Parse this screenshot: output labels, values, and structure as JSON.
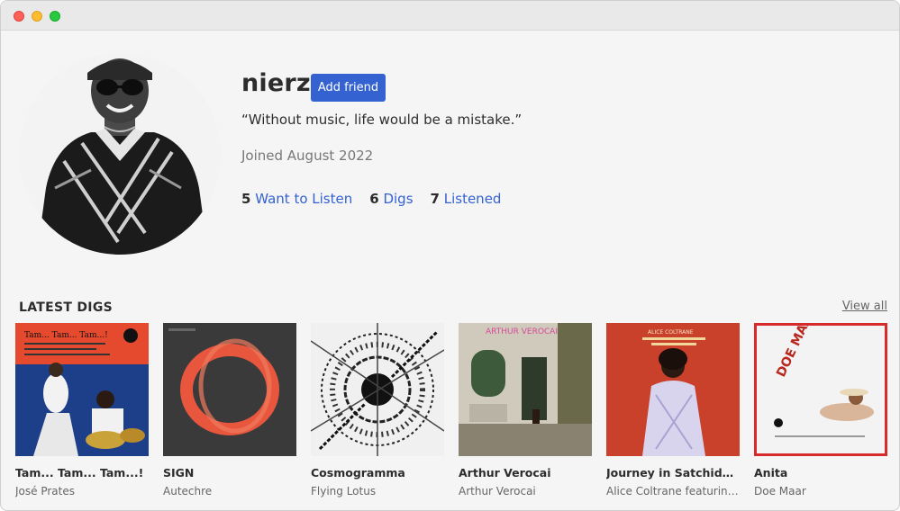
{
  "profile": {
    "username": "nierz",
    "add_friend_label": "Add friend",
    "quote": "“Without music, life would be a mistake.”",
    "joined": "Joined August 2022",
    "stats": [
      {
        "count": "5",
        "label": "Want to Listen"
      },
      {
        "count": "6",
        "label": "Digs"
      },
      {
        "count": "7",
        "label": "Listened"
      }
    ]
  },
  "latest_digs": {
    "title": "LATEST DIGS",
    "view_all_label": "View all",
    "items": [
      {
        "title": "Tam... Tam... Tam...!",
        "artist": "José Prates",
        "cover_text": "Tam... Tam... Tam...!"
      },
      {
        "title": "SIGN",
        "artist": "Autechre",
        "cover_text": ""
      },
      {
        "title": "Cosmogramma",
        "artist": "Flying Lotus",
        "cover_text": ""
      },
      {
        "title": "Arthur Verocai",
        "artist": "Arthur Verocai",
        "cover_text": "ARTHUR VEROCAI"
      },
      {
        "title": "Journey in Satchidananda",
        "artist": "Alice Coltrane featuring Pharoah Sanders",
        "cover_text": "ALICE COLTRANE"
      },
      {
        "title": "Anita",
        "artist": "Doe Maar",
        "cover_text": "DOE MAAR"
      }
    ]
  },
  "colors": {
    "accent": "#3462d1",
    "background": "#f5f5f5"
  }
}
